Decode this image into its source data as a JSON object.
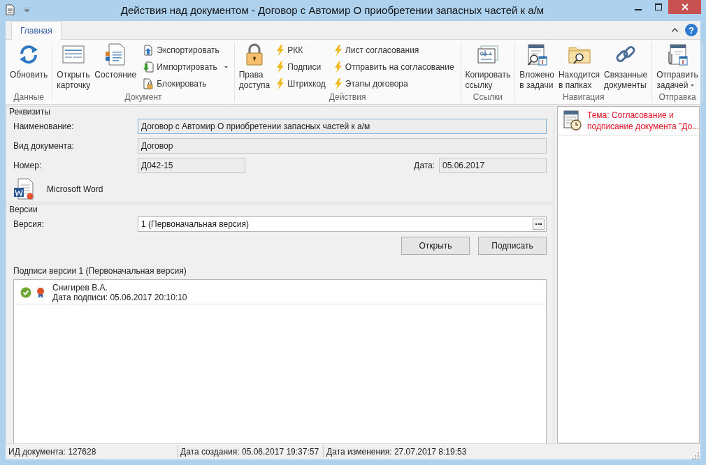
{
  "window": {
    "title": "Действия над документом - Договор с Автомир О приобретении запасных частей к а/м",
    "help": "?"
  },
  "ribbon": {
    "tabs": [
      {
        "label": "Главная",
        "selected": true
      }
    ],
    "groups": [
      {
        "label": "Данные",
        "items": [
          {
            "kind": "large",
            "lines": [
              "Обновить"
            ],
            "dropdown": false
          }
        ]
      },
      {
        "label": "Документ",
        "items": [
          {
            "kind": "large",
            "lines": [
              "Открыть",
              "карточку"
            ],
            "dropdown": false
          },
          {
            "kind": "large",
            "lines": [
              "Состояние"
            ],
            "dropdown": false
          },
          {
            "kind": "stack",
            "entries": [
              {
                "label": "Экспортировать",
                "dropdown": false
              },
              {
                "label": "Импортировать",
                "dropdown": true
              },
              {
                "label": "Блокировать",
                "dropdown": false
              }
            ]
          }
        ]
      },
      {
        "label": "Действия",
        "items": [
          {
            "kind": "large",
            "lines": [
              "Права",
              "доступа"
            ],
            "dropdown": false
          },
          {
            "kind": "stack",
            "entries": [
              {
                "label": "РКК",
                "dropdown": false
              },
              {
                "label": "Подписи",
                "dropdown": false
              },
              {
                "label": "Штрихкод",
                "dropdown": false
              }
            ]
          },
          {
            "kind": "stack",
            "entries": [
              {
                "label": "Лист согласования",
                "dropdown": false
              },
              {
                "label": "Отправить на согласование",
                "dropdown": false
              },
              {
                "label": "Этапы договора",
                "dropdown": false
              }
            ]
          }
        ]
      },
      {
        "label": "Ссылки",
        "items": [
          {
            "kind": "large",
            "lines": [
              "Копировать",
              "ссылку"
            ],
            "dropdown": false
          }
        ]
      },
      {
        "label": "Навигация",
        "items": [
          {
            "kind": "large",
            "lines": [
              "Вложено",
              "в задачи"
            ],
            "dropdown": false
          },
          {
            "kind": "large",
            "lines": [
              "Находится",
              "в папках"
            ],
            "dropdown": false
          },
          {
            "kind": "large",
            "lines": [
              "Связанные",
              "документы"
            ],
            "dropdown": false
          }
        ]
      },
      {
        "label": "Отправка",
        "items": [
          {
            "kind": "large",
            "lines": [
              "Отправить",
              "задачей"
            ],
            "dropdown": true
          }
        ]
      }
    ]
  },
  "details": {
    "title": "Реквизиты",
    "name": {
      "label": "Наименование:",
      "value": "Договор с Автомир О приобретении запасных частей к а/м",
      "focused": true
    },
    "type": {
      "label": "Вид документа:",
      "value": "Договор",
      "focused": false
    },
    "number": {
      "label": "Номер:",
      "value": "Д042-15",
      "focused": false
    },
    "date": {
      "label": "Дата:",
      "value": "05.06.2017",
      "focused": false
    },
    "file": {
      "name": "Microsoft Word"
    }
  },
  "versions": {
    "title": "Версии",
    "version": {
      "label": "Версия:",
      "value": "1 (Первоначальная версия)"
    },
    "buttons": [
      "Открыть",
      "Подписать"
    ],
    "signatures_title": "Подписи версии 1 (Первоначальная версия)",
    "signatures": [
      {
        "name": "Снигирев В.А.",
        "date": "Дата подписи: 05.06.2017 20:10:10",
        "valid": true
      }
    ]
  },
  "tasks": [
    {
      "lines": [
        "Тема: Согласование и",
        "подписание документа \"До..."
      ],
      "color": "#e81123"
    }
  ],
  "status_bar": [
    "ИД документа: 127628",
    "Дата создания: 05.06.2017 19:37:57",
    "Дата изменения: 27.07.2017 8:19:53"
  ]
}
